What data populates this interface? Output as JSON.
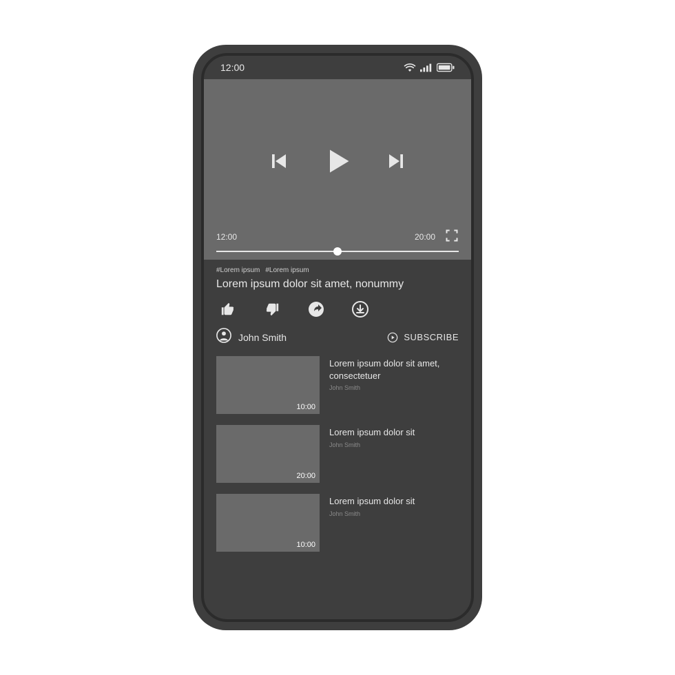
{
  "status": {
    "time": "12:00"
  },
  "player": {
    "current_time": "12:00",
    "total_time": "20:00",
    "progress_pct": 50
  },
  "video": {
    "hashtags": [
      "#Lorem ipsum",
      "#Lorem ipsum"
    ],
    "title": "Lorem ipsum dolor sit amet, nonummy"
  },
  "channel": {
    "name": "John Smith",
    "subscribe_label": "SUBSCRIBE"
  },
  "related": [
    {
      "title": "Lorem ipsum dolor sit amet, consectetuer",
      "author": "John Smith",
      "duration": "10:00"
    },
    {
      "title": "Lorem ipsum dolor sit",
      "author": "John Smith",
      "duration": "20:00"
    },
    {
      "title": "Lorem ipsum dolor sit",
      "author": "John Smith",
      "duration": "10:00"
    }
  ]
}
